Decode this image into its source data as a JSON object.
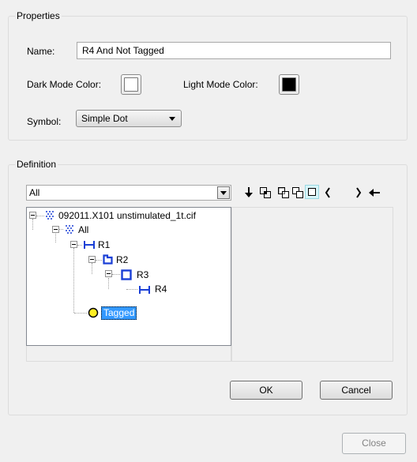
{
  "properties": {
    "title": "Properties",
    "name_label": "Name:",
    "name_value": "R4  And  Not  Tagged",
    "dark_mode_label": "Dark Mode Color:",
    "dark_mode_color": "#ffffff",
    "light_mode_label": "Light Mode Color:",
    "light_mode_color": "#000000",
    "symbol_label": "Symbol:",
    "symbol_value": "Simple Dot"
  },
  "definition": {
    "title": "Definition",
    "population_select": "All",
    "toolbar": [
      "down-arrow-icon",
      "and-icon",
      "or-icon",
      "not-icon",
      "open-paren-icon",
      "close-paren-icon",
      "backspace-icon"
    ],
    "tree": {
      "root": "092011.X101 unstimulated_1t.cif",
      "all": "All",
      "r1": "R1",
      "r2": "R2",
      "r3": "R3",
      "r4": "R4",
      "tagged": "Tagged"
    },
    "colors": {
      "population_blue": "#1a3fd6",
      "tagged_yellow": "#ffee22",
      "selection": "#3399ff"
    }
  },
  "buttons": {
    "ok": "OK",
    "cancel": "Cancel",
    "close": "Close"
  }
}
